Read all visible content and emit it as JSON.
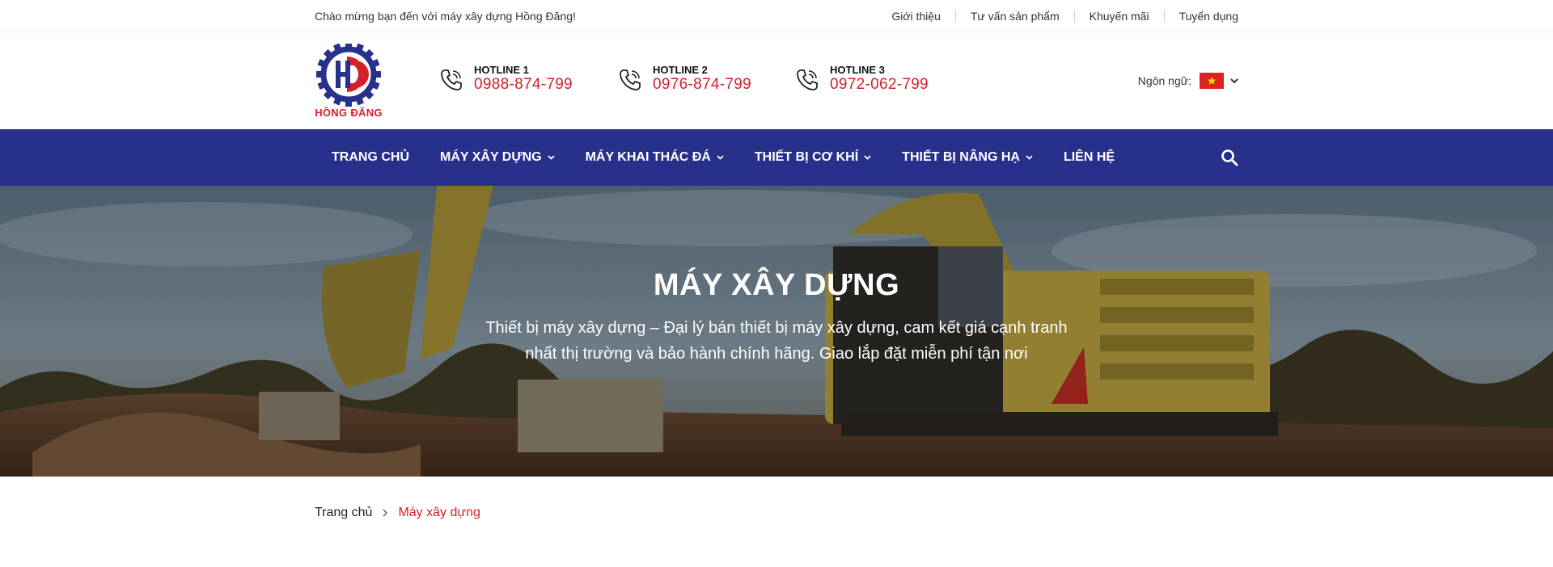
{
  "topbar": {
    "welcome": "Chào mừng bạn đến với máy xây dựng Hồng Đăng!",
    "links": [
      "Giới thiệu",
      "Tư vấn sản phẩm",
      "Khuyến mãi",
      "Tuyển dụng"
    ]
  },
  "header": {
    "logo_text": "HỒNG ĐĂNG",
    "hotlines": [
      {
        "label": "HOTLINE 1",
        "number": "0988-874-799"
      },
      {
        "label": "HOTLINE 2",
        "number": "0976-874-799"
      },
      {
        "label": "HOTLINE 3",
        "number": "0972-062-799"
      }
    ],
    "language_label": "Ngôn ngữ:",
    "language_flag": "vietnam-flag-icon"
  },
  "nav": {
    "items": [
      {
        "label": "TRANG CHỦ",
        "has_dropdown": false
      },
      {
        "label": "MÁY XÂY DỰNG",
        "has_dropdown": true
      },
      {
        "label": "MÁY KHAI THÁC ĐÁ",
        "has_dropdown": true
      },
      {
        "label": "THIẾT BỊ CƠ KHÍ",
        "has_dropdown": true
      },
      {
        "label": "THIẾT BỊ NÂNG HẠ",
        "has_dropdown": true
      },
      {
        "label": "LIÊN HỆ",
        "has_dropdown": false
      }
    ],
    "search_icon": "search-icon"
  },
  "hero": {
    "title": "MÁY XÂY DỰNG",
    "description": "Thiết bị máy xây dựng – Đại lý bán thiết bị máy xây dựng, cam kết giá cạnh tranh nhất thị trường và bảo hành chính hãng. Giao lắp đặt miễn phí tận nơi"
  },
  "breadcrumb": {
    "home": "Trang chủ",
    "current": "Máy xây dựng"
  },
  "colors": {
    "brand_blue": "#27318b",
    "accent_red": "#d4202a",
    "topbar_text": "#333333"
  }
}
